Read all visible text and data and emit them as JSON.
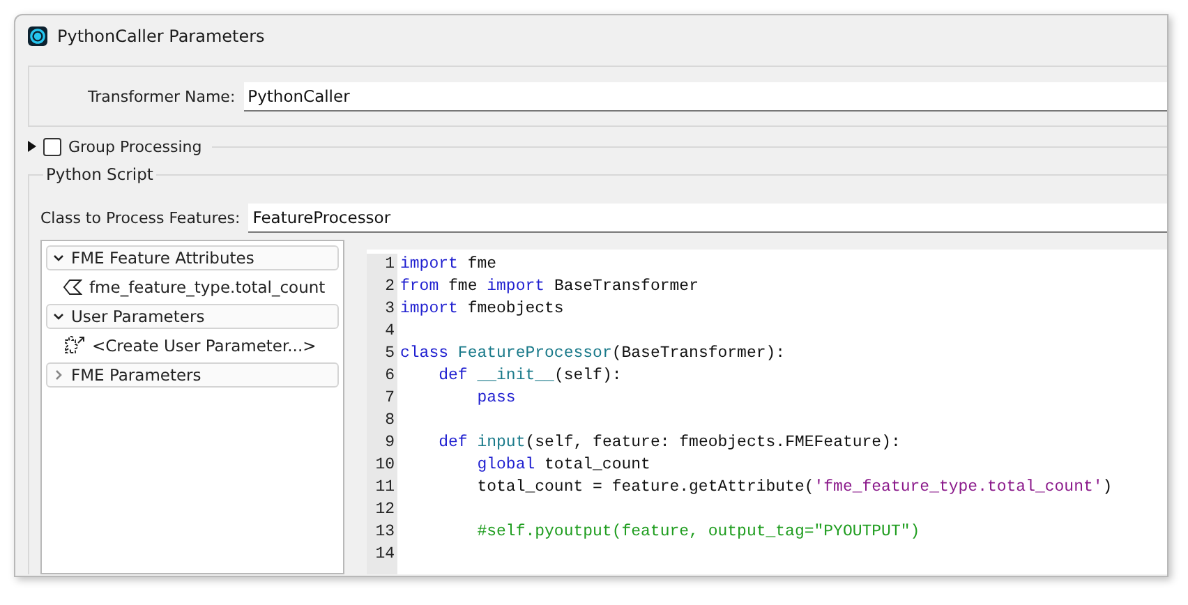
{
  "window": {
    "title": "PythonCaller Parameters"
  },
  "transformer_name": {
    "label": "Transformer Name:",
    "value": "PythonCaller"
  },
  "group_processing": {
    "label": "Group Processing",
    "expanded": false,
    "checked": false
  },
  "python_script": {
    "title": "Python Script",
    "class_label": "Class to Process Features:",
    "class_value": "FeatureProcessor",
    "tree": [
      {
        "label": "FME Feature Attributes",
        "expanded": true,
        "children": [
          {
            "kind": "attribute",
            "label": "fme_feature_type.total_count"
          }
        ]
      },
      {
        "label": "User Parameters",
        "expanded": true,
        "children": [
          {
            "kind": "create",
            "label": "<Create User Parameter...>"
          }
        ]
      },
      {
        "label": "FME Parameters",
        "expanded": false
      }
    ],
    "code": [
      {
        "number": "1",
        "tokens": [
          {
            "kind": "keyword",
            "text": "import"
          },
          {
            "kind": "plain",
            "text": " fme"
          }
        ]
      },
      {
        "number": "2",
        "tokens": [
          {
            "kind": "keyword",
            "text": "from"
          },
          {
            "kind": "plain",
            "text": " fme "
          },
          {
            "kind": "keyword",
            "text": "import"
          },
          {
            "kind": "plain",
            "text": " BaseTransformer"
          }
        ]
      },
      {
        "number": "3",
        "tokens": [
          {
            "kind": "keyword",
            "text": "import"
          },
          {
            "kind": "plain",
            "text": " fmeobjects"
          }
        ]
      },
      {
        "number": "4"
      },
      {
        "number": "5",
        "tokens": [
          {
            "kind": "keyword",
            "text": "class "
          },
          {
            "kind": "name",
            "text": "FeatureProcessor"
          },
          {
            "kind": "plain",
            "text": "(BaseTransformer):"
          }
        ]
      },
      {
        "number": "6",
        "tokens": [
          {
            "kind": "keyword",
            "text": "    def "
          },
          {
            "kind": "name",
            "text": "__init__"
          },
          {
            "kind": "plain",
            "text": "(self):"
          }
        ]
      },
      {
        "number": "7",
        "tokens": [
          {
            "kind": "keyword",
            "text": "        pass"
          }
        ]
      },
      {
        "number": "8"
      },
      {
        "number": "9",
        "tokens": [
          {
            "kind": "keyword",
            "text": "    def "
          },
          {
            "kind": "name",
            "text": "input"
          },
          {
            "kind": "plain",
            "text": "(self, feature: fmeobjects.FMEFeature):"
          }
        ]
      },
      {
        "number": "10",
        "tokens": [
          {
            "kind": "keyword",
            "text": "        global"
          },
          {
            "kind": "plain",
            "text": " total_count"
          }
        ]
      },
      {
        "number": "11",
        "tokens": [
          {
            "kind": "plain",
            "text": "        total_count = feature.getAttribute("
          },
          {
            "kind": "string",
            "text": "'fme_feature_type.total_count'"
          },
          {
            "kind": "plain",
            "text": ")"
          }
        ]
      },
      {
        "number": "12"
      },
      {
        "number": "13",
        "tokens": [
          {
            "kind": "comment",
            "text": "        #self.pyoutput(feature, output_tag=\"PYOUTPUT\")"
          }
        ]
      },
      {
        "number": "14"
      }
    ]
  }
}
